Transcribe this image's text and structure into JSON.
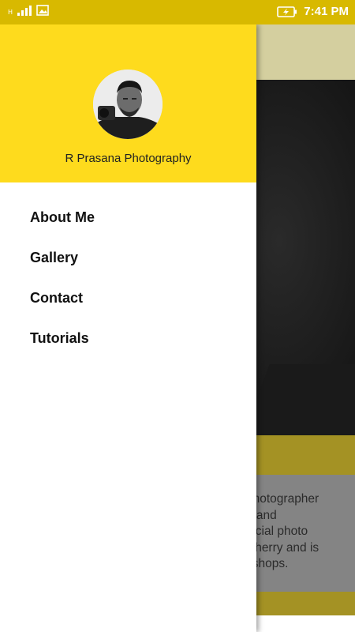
{
  "status_bar": {
    "network_label": "H",
    "time": "7:41 PM"
  },
  "drawer": {
    "header_title": "R Prasana Photography",
    "menu_items": [
      {
        "label": "About Me"
      },
      {
        "label": "Gallery"
      },
      {
        "label": "Contact"
      },
      {
        "label": "Tutorials"
      }
    ]
  },
  "background": {
    "text_lines": [
      "photographer",
      "e and",
      "fficial photo",
      "icherry and is",
      "kshops."
    ]
  },
  "colors": {
    "status_bar": "#d8b900",
    "drawer_header": "#fedb1d",
    "section_bar": "#a49224"
  }
}
